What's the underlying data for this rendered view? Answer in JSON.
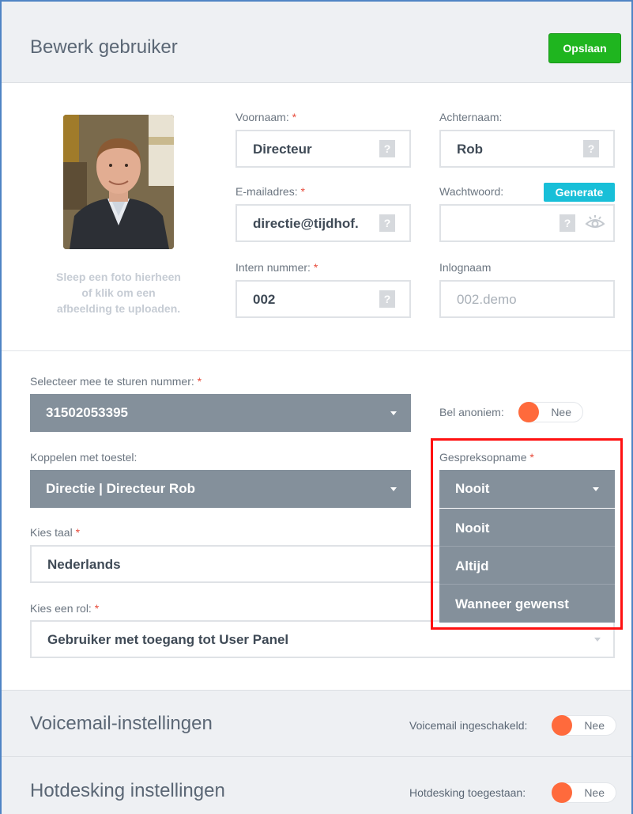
{
  "header": {
    "title": "Bewerk gebruiker",
    "save_label": "Opslaan"
  },
  "photo": {
    "hint": "Sleep een foto hierheen of klik om een afbeelding te uploaden."
  },
  "fields": {
    "firstname": {
      "label": "Voornaam:",
      "required": "*",
      "value": "Directeur",
      "help": "?"
    },
    "lastname": {
      "label": "Achternaam:",
      "value": "Rob",
      "help": "?"
    },
    "email": {
      "label": "E-mailadres:",
      "required": "*",
      "value": "directie@tijdhof.",
      "help": "?"
    },
    "password": {
      "label": "Wachtwoord:",
      "value": "",
      "help": "?",
      "generate_label": "Generate"
    },
    "extension": {
      "label": "Intern nummer:",
      "required": "*",
      "value": "002",
      "help": "?"
    },
    "login": {
      "label": "Inlognaam",
      "placeholder": "002.demo"
    }
  },
  "caller_id": {
    "label": "Selecteer mee te sturen nummer:",
    "required": "*",
    "value": "31502053395"
  },
  "anonymous": {
    "label": "Bel anoniem:",
    "state": "Nee"
  },
  "device": {
    "label": "Koppelen met toestel:",
    "value": "Directie | Directeur Rob"
  },
  "recording": {
    "label": "Gespreksopname",
    "required": "*",
    "value": "Nooit",
    "options": [
      "Nooit",
      "Altijd",
      "Wanneer gewenst"
    ]
  },
  "language": {
    "label": "Kies taal",
    "required": "*",
    "value": "Nederlands"
  },
  "role": {
    "label": "Kies een rol:",
    "required": "*",
    "value": "Gebruiker met toegang tot User Panel"
  },
  "voicemail": {
    "title": "Voicemail-instellingen",
    "label": "Voicemail ingeschakeld:",
    "state": "Nee"
  },
  "hotdesking": {
    "title": "Hotdesking instellingen",
    "label": "Hotdesking toegestaan:",
    "state": "Nee"
  },
  "colors": {
    "save": "#1fb51f",
    "generate": "#18bfd8",
    "select": "#84909b",
    "toggle_knob": "#ff6a3c",
    "highlight": "#ff1111",
    "required": "#e74c3c"
  }
}
